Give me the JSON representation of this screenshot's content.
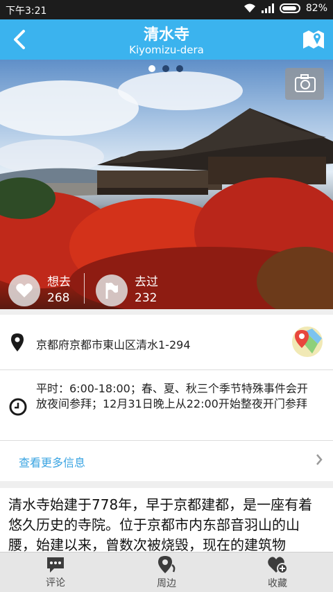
{
  "status": {
    "time": "下午3:21",
    "battery": "82%"
  },
  "header": {
    "title": "清水寺",
    "subtitle": "Kiyomizu-dera"
  },
  "carousel": {
    "current": 1,
    "total": 3
  },
  "stats": [
    {
      "label": "想去",
      "count": "268",
      "icon": "heart-icon"
    },
    {
      "label": "去过",
      "count": "232",
      "icon": "flag-icon"
    }
  ],
  "info": {
    "address": "京都府京都市東山区清水1-294",
    "hours": "平时：6:00-18:00；春、夏、秋三个季节特殊事件会开放夜间参拜；12月31日晚上从22:00开始整夜开门参拜",
    "more_link": "查看更多信息"
  },
  "description": "清水寺始建于778年，早于京都建都，是一座有着悠久历史的寺院。位于京都市内东部音羽山的山腰，始建以来，曾数次被烧毁，现在的建筑物",
  "bottom_nav": [
    {
      "label": "评论",
      "icon": "comment-icon"
    },
    {
      "label": "周边",
      "icon": "nearby-icon"
    },
    {
      "label": "收藏",
      "icon": "favorite-add-icon"
    }
  ],
  "colors": {
    "primary": "#3bb3ee",
    "link": "#3aa4e2"
  }
}
